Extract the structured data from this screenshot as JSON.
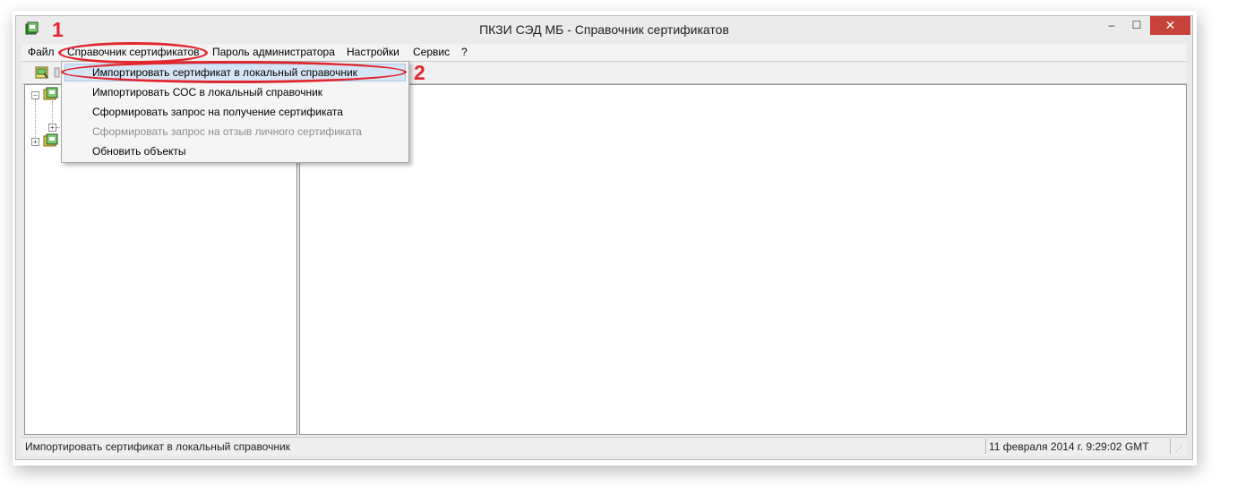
{
  "window": {
    "title": "ПКЗИ СЭД МБ - Справочник сертификатов",
    "controls": {
      "minimize": "–",
      "maximize": "☐",
      "close": "✕"
    }
  },
  "menubar": {
    "items": [
      "Файл",
      "Справочник сертификатов",
      "Пароль администратора",
      "Настройки",
      "Сервис",
      "?"
    ]
  },
  "dropdown": {
    "items": [
      {
        "label": "Импортировать сертификат в локальный справочник",
        "enabled": true,
        "highlighted": true
      },
      {
        "label": "Импортировать СОС в локальный справочник",
        "enabled": true
      },
      {
        "label": "Сформировать запрос на получение сертификата",
        "enabled": true
      },
      {
        "label": "Сформировать запрос на отзыв личного сертификата",
        "enabled": false
      },
      {
        "label": "Обновить объекты",
        "enabled": true
      }
    ]
  },
  "tree": {
    "expand_minus": "−",
    "expand_plus": "+"
  },
  "statusbar": {
    "message": "Импортировать сертификат в локальный справочник",
    "datetime": "11 февраля 2014 г. 9:29:02 GMT"
  },
  "annotations": {
    "step1": "1",
    "step2": "2",
    "color": "#e0262e"
  },
  "icons": [
    "app-certificate-icon",
    "toolbar-certificate-icon",
    "tree-folder-icon"
  ]
}
